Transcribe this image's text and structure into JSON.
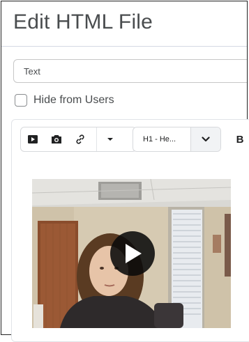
{
  "page": {
    "title": "Edit HTML File"
  },
  "form": {
    "title_value": "Text",
    "hide_from_users_label": "Hide from Users",
    "hide_from_users_checked": false
  },
  "editor": {
    "toolbar": {
      "insert_buttons": [
        {
          "icon": "video-icon"
        },
        {
          "icon": "camera-icon"
        },
        {
          "icon": "link-icon"
        },
        {
          "icon": "chevron-down-icon"
        }
      ],
      "format_select_value": "H1 - He...",
      "bold_label": "B"
    },
    "content": {
      "video": {
        "icon": "play-icon"
      }
    }
  }
}
